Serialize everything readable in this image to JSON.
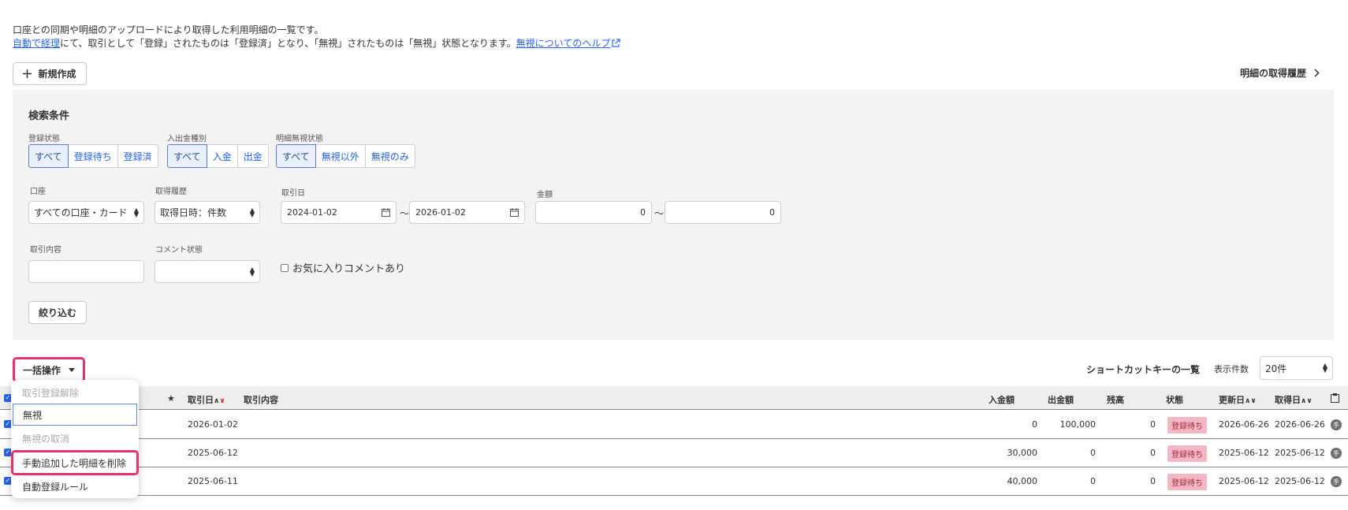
{
  "description": {
    "line1": "口座との同期や明細のアップロードにより取得した利用明細の一覧です。",
    "line2_link": "自動で経理",
    "line2_text": "にて、取引として「登録」されたものは「登録済」となり、「無視」されたものは「無視」状態となります。",
    "help_link": "無視についてのヘルプ"
  },
  "toolbar": {
    "new_label": "新規作成",
    "history_label": "明細の取得履歴"
  },
  "search": {
    "title": "検索条件",
    "status_label": "登録状態",
    "status_options": [
      "すべて",
      "登録待ち",
      "登録済"
    ],
    "type_label": "入出金種別",
    "type_options": [
      "すべて",
      "入金",
      "出金"
    ],
    "ignore_label": "明細無視状態",
    "ignore_options": [
      "すべて",
      "無視以外",
      "無視のみ"
    ],
    "account_label": "口座",
    "account_value": "すべての口座・カード",
    "history_label": "取得履歴",
    "history_value": "取得日時：件数",
    "date_label": "取引日",
    "date_from": "2024-01-02",
    "date_to": "2026-01-02",
    "amount_label": "金額",
    "amount_from": "0",
    "amount_to": "0",
    "tilde": "〜",
    "content_label": "取引内容",
    "content_value": "",
    "comment_label": "コメント状態",
    "comment_value": "",
    "favorite_label": "お気に入りコメントあり",
    "filter_button": "絞り込む"
  },
  "list": {
    "bulk_label": "一括操作",
    "shortcut_label": "ショートカットキーの一覧",
    "perpage_label": "表示件数",
    "perpage_value": "20件",
    "columns": {
      "star": "★",
      "date": "取引日",
      "content": "取引内容",
      "deposit": "入金額",
      "withdrawal": "出金額",
      "balance": "残高",
      "status": "状態",
      "updated": "更新日",
      "acquired": "取得日"
    },
    "sort_up": "∧",
    "sort_down": "∨",
    "rows": [
      {
        "date": "2026-01-02",
        "deposit": "0",
        "withdrawal": "100,000",
        "balance": "0",
        "status": "登録待ち",
        "updated": "2026-06-26",
        "acquired": "2026-06-26",
        "kind": "手"
      },
      {
        "date": "2025-06-12",
        "deposit": "30,000",
        "withdrawal": "0",
        "balance": "0",
        "status": "登録待ち",
        "updated": "2025-06-12",
        "acquired": "2025-06-12",
        "kind": "手"
      },
      {
        "date": "2025-06-11",
        "deposit": "40,000",
        "withdrawal": "0",
        "balance": "0",
        "status": "登録待ち",
        "updated": "2025-06-12",
        "acquired": "2025-06-12",
        "kind": "手"
      }
    ]
  },
  "bulk_menu": {
    "items": [
      "取引登録解除",
      "無視",
      "無視の取消",
      "手動追加した明細を削除",
      "自動登録ルール"
    ]
  },
  "colors": {
    "accent": "#e8306a",
    "link": "#2864f0",
    "badge_bg": "#f4b8c4"
  }
}
